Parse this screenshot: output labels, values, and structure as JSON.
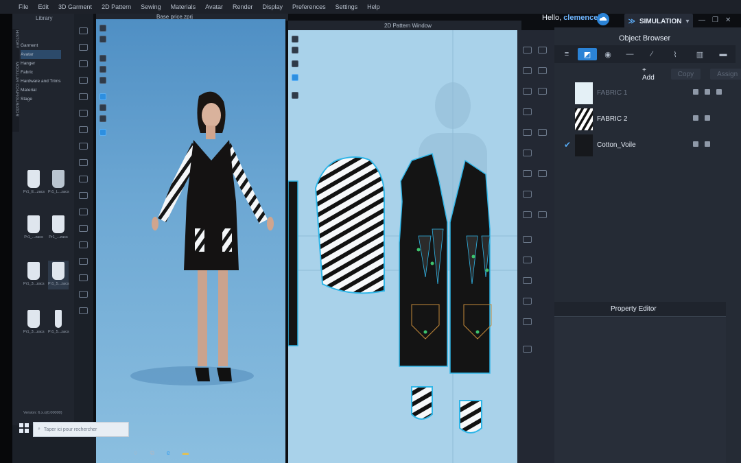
{
  "menu": {
    "items": [
      "File",
      "Edit",
      "3D Garment",
      "2D Pattern",
      "Sewing",
      "Materials",
      "Avatar",
      "Render",
      "Display",
      "Preferences",
      "Settings",
      "Help"
    ],
    "greeting_prefix": "Hello,",
    "username": "clemencel",
    "simulation_label": "SIMULATION"
  },
  "library": {
    "title": "Library",
    "side_tabs": [
      "HISTORY",
      "MODULAR CONFIGURATOR"
    ],
    "categories": [
      "Garment",
      "Avatar",
      "Hanger",
      "Fabric",
      "Hardware and Trims",
      "Material",
      "Stage"
    ],
    "thumbnails": [
      "Pr1_E...zacs",
      "Pr1_L...zacs",
      "Pr1_...zacs",
      "Pr1_...zacs",
      "Pr1_3...zacs",
      "Pr1_5...zacs"
    ],
    "version": "Version: 6.x.x(0.00000)"
  },
  "viewport3d": {
    "title": "Base price.zprj"
  },
  "pattern_window": {
    "title": "2D Pattern Window"
  },
  "object_browser": {
    "title": "Object Browser",
    "tabs": [
      "list-icon",
      "fabric-icon",
      "button-icon",
      "zipper-icon",
      "topstitch-icon",
      "tape-icon",
      "puckering-icon",
      "knit-icon"
    ],
    "add_label": "+ Add",
    "copy_label": "Copy",
    "assign_label": "Assign",
    "fabrics": [
      {
        "name": "FABRIC 1",
        "swatch": "#e4f0f6",
        "selected": false,
        "faded": true
      },
      {
        "name": "FABRIC 2",
        "swatch": "zebra",
        "selected": false,
        "faded": false
      },
      {
        "name": "Cotton_Voile",
        "swatch": "#16181c",
        "selected": true,
        "faded": false
      }
    ]
  },
  "property_editor": {
    "title": "Property Editor"
  },
  "taskbar": {
    "search_placeholder": "Taper ici pour rechercher"
  },
  "colors": {
    "accent": "#2b83d6",
    "viewport_top": "#4f8fc4",
    "pattern_bg": "#a9d2ea",
    "panel": "#252b35",
    "outline": "#2fb6e8"
  }
}
